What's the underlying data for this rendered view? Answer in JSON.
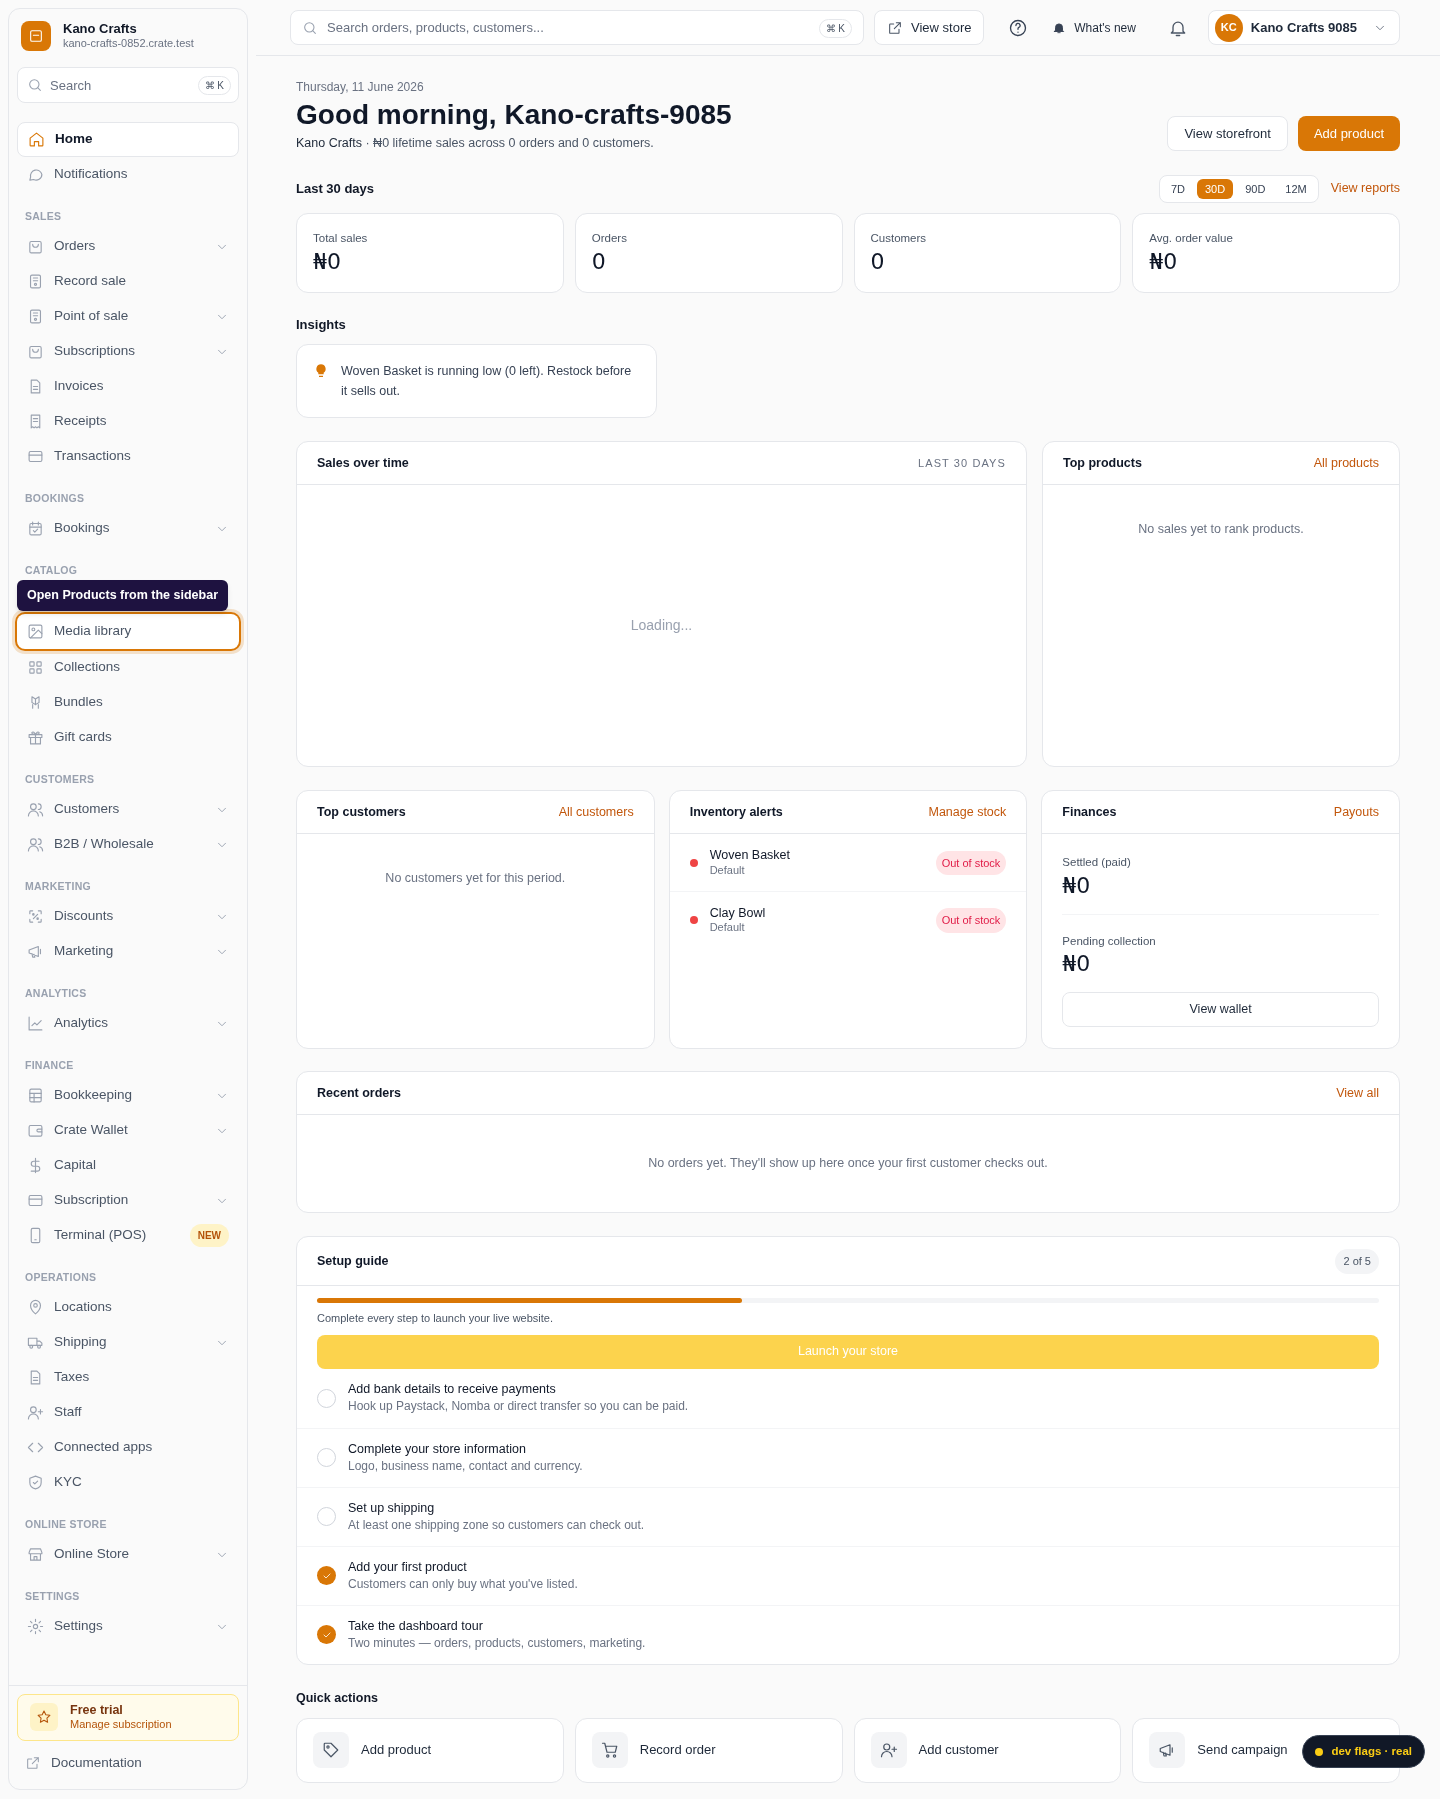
{
  "sidebar": {
    "brand": {
      "name": "Kano Crafts",
      "domain": "kano-crafts-0852.crate.test"
    },
    "search": {
      "placeholder": "Search",
      "shortcut": "⌘ K"
    },
    "sections": [
      {
        "items": [
          {
            "label": "Home",
            "selected": true,
            "expandable": false,
            "highlighted": false
          },
          {
            "label": "Notifications",
            "selected": false,
            "expandable": false,
            "highlighted": false
          }
        ]
      },
      {
        "label": "SALES",
        "items": [
          {
            "label": "Orders",
            "selected": false,
            "expandable": true,
            "highlighted": false
          },
          {
            "label": "Record sale",
            "selected": false,
            "expandable": false,
            "highlighted": false
          },
          {
            "label": "Point of sale",
            "selected": false,
            "expandable": true,
            "highlighted": false
          },
          {
            "label": "Subscriptions",
            "selected": false,
            "expandable": true,
            "highlighted": false
          },
          {
            "label": "Invoices",
            "selected": false,
            "expandable": false,
            "highlighted": false
          },
          {
            "label": "Receipts",
            "selected": false,
            "expandable": false,
            "highlighted": false
          },
          {
            "label": "Transactions",
            "selected": false,
            "expandable": false,
            "highlighted": false
          }
        ]
      },
      {
        "label": "BOOKINGS",
        "items": [
          {
            "label": "Bookings",
            "selected": false,
            "expandable": true,
            "highlighted": false
          }
        ]
      },
      {
        "label": "CATALOG",
        "tooltip": "Open Products from the sidebar",
        "items": [
          {
            "label": "Media library",
            "selected": false,
            "expandable": false,
            "highlighted": true
          },
          {
            "label": "Collections",
            "selected": false,
            "expandable": false,
            "highlighted": false
          },
          {
            "label": "Bundles",
            "selected": false,
            "expandable": false,
            "highlighted": false
          },
          {
            "label": "Gift cards",
            "selected": false,
            "expandable": false,
            "highlighted": false
          }
        ]
      },
      {
        "label": "CUSTOMERS",
        "items": [
          {
            "label": "Customers",
            "selected": false,
            "expandable": true,
            "highlighted": false
          },
          {
            "label": "B2B / Wholesale",
            "selected": false,
            "expandable": true,
            "highlighted": false
          }
        ]
      },
      {
        "label": "MARKETING",
        "items": [
          {
            "label": "Discounts",
            "selected": false,
            "expandable": true,
            "highlighted": false
          },
          {
            "label": "Marketing",
            "selected": false,
            "expandable": true,
            "highlighted": false
          }
        ]
      },
      {
        "label": "ANALYTICS",
        "items": [
          {
            "label": "Analytics",
            "selected": false,
            "expandable": true,
            "highlighted": false
          }
        ]
      },
      {
        "label": "FINANCE",
        "items": [
          {
            "label": "Bookkeeping",
            "selected": false,
            "expandable": true,
            "highlighted": false
          },
          {
            "label": "Crate Wallet",
            "selected": false,
            "expandable": true,
            "highlighted": false
          },
          {
            "label": "Capital",
            "selected": false,
            "expandable": false,
            "highlighted": false
          },
          {
            "label": "Subscription",
            "selected": false,
            "expandable": true,
            "highlighted": false
          },
          {
            "label": "Terminal (POS)",
            "selected": false,
            "expandable": false,
            "highlighted": false,
            "badge": "NEW"
          }
        ]
      },
      {
        "label": "OPERATIONS",
        "items": [
          {
            "label": "Locations",
            "selected": false,
            "expandable": false,
            "highlighted": false
          },
          {
            "label": "Shipping",
            "selected": false,
            "expandable": true,
            "highlighted": false
          },
          {
            "label": "Taxes",
            "selected": false,
            "expandable": false,
            "highlighted": false
          },
          {
            "label": "Staff",
            "selected": false,
            "expandable": false,
            "highlighted": false
          },
          {
            "label": "Connected apps",
            "selected": false,
            "expandable": false,
            "highlighted": false
          },
          {
            "label": "KYC",
            "selected": false,
            "expandable": false,
            "highlighted": false
          }
        ]
      },
      {
        "label": "ONLINE STORE",
        "items": [
          {
            "label": "Online Store",
            "selected": false,
            "expandable": true,
            "highlighted": false
          }
        ]
      },
      {
        "label": "SETTINGS",
        "items": [
          {
            "label": "Settings",
            "selected": false,
            "expandable": true,
            "highlighted": false
          }
        ]
      }
    ],
    "trial": {
      "title": "Free trial",
      "subtitle": "Manage subscription"
    },
    "documentation": "Documentation"
  },
  "topbar": {
    "search": {
      "placeholder": "Search orders, products, customers...",
      "shortcut": "⌘ K"
    },
    "view_store": "View store",
    "whats_new": "What's new",
    "account": {
      "initials": "KC",
      "name": "Kano Crafts 9085"
    }
  },
  "header": {
    "date": "Thursday, 11 June 2026",
    "greeting": "Good morning, Kano-crafts-9085",
    "summary": "**Kano Crafts** · ₦0 lifetime sales across 0 orders and 0 customers.",
    "buttons": [
      {
        "label": "View storefront",
        "primary": false
      },
      {
        "label": "Add product",
        "primary": true
      }
    ]
  },
  "period": {
    "label": "Last 30 days",
    "options": [
      {
        "label": "7D",
        "selected": false
      },
      {
        "label": "30D",
        "selected": true
      },
      {
        "label": "90D",
        "selected": false
      },
      {
        "label": "12M",
        "selected": false
      }
    ],
    "link": "View reports"
  },
  "stats": [
    {
      "label": "Total sales",
      "value": "₦0"
    },
    {
      "label": "Orders",
      "value": "0"
    },
    {
      "label": "Customers",
      "value": "0"
    },
    {
      "label": "Avg. order value",
      "value": "₦0"
    }
  ],
  "insights": {
    "title": "Insights",
    "items": [
      "Woven Basket is running low (0 left). Restock before it sells out."
    ]
  },
  "sales_over_time": {
    "title": "Sales over time",
    "range": "LAST 30 DAYS",
    "status": "Loading..."
  },
  "top_products": {
    "title": "Top products",
    "link": "All products",
    "empty": "No sales yet to rank products."
  },
  "top_customers": {
    "title": "Top customers",
    "link": "All customers",
    "empty": "No customers yet for this period."
  },
  "inventory_alerts": {
    "title": "Inventory alerts",
    "link": "Manage stock",
    "items": [
      {
        "name": "Woven Basket",
        "variant": "Default",
        "status": "Out of stock",
        "color": "#ef4444"
      },
      {
        "name": "Clay Bowl",
        "variant": "Default",
        "status": "Out of stock",
        "color": "#ef4444"
      }
    ]
  },
  "finances": {
    "title": "Finances",
    "link": "Payouts",
    "entries": [
      {
        "label": "Settled (paid)",
        "value": "₦0"
      },
      {
        "label": "Pending collection",
        "value": "₦0"
      }
    ],
    "button": "View wallet"
  },
  "recent_orders": {
    "title": "Recent orders",
    "link": "View all",
    "empty": "No orders yet. They'll show up here once your first customer checks out."
  },
  "setup_guide": {
    "title": "Setup guide",
    "count": "2 of 5",
    "level": 0.4,
    "note": "Complete every step to launch your live website.",
    "button": "Launch your store",
    "steps": [
      {
        "title": "Add bank details to receive payments",
        "description": "Hook up Paystack, Nomba or direct transfer so you can be paid.",
        "checked": false
      },
      {
        "title": "Complete your store information",
        "description": "Logo, business name, contact and currency.",
        "checked": false
      },
      {
        "title": "Set up shipping",
        "description": "At least one shipping zone so customers can check out.",
        "checked": false
      },
      {
        "title": "Add your first product",
        "description": "Customers can only buy what you've listed.",
        "checked": true
      },
      {
        "title": "Take the dashboard tour",
        "description": "Two minutes — orders, products, customers, marketing.",
        "checked": true
      }
    ]
  },
  "quick_actions": {
    "title": "Quick actions",
    "items": [
      "Add product",
      "Record order",
      "Add customer",
      "Send campaign"
    ]
  },
  "dev_badge": {
    "label": "dev flags · real",
    "color": "#facc15"
  }
}
